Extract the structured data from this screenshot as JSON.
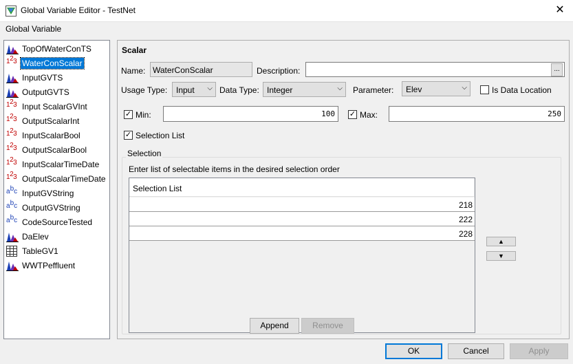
{
  "window": {
    "title": "Global Variable Editor - TestNet",
    "close_label": "✕"
  },
  "menu": {
    "label": "Global Variable"
  },
  "tree": {
    "items": [
      {
        "label": "TopOfWaterConTS",
        "icon": "timeseries-icon"
      },
      {
        "label": "WaterConScalar",
        "icon": "numeric-icon",
        "selected": true
      },
      {
        "label": "InputGVTS",
        "icon": "timeseries-icon"
      },
      {
        "label": "OutputGVTS",
        "icon": "timeseries-icon"
      },
      {
        "label": "Input ScalarGVInt",
        "icon": "numeric-icon"
      },
      {
        "label": "OutputScalarInt",
        "icon": "numeric-icon"
      },
      {
        "label": "InputScalarBool",
        "icon": "numeric-icon"
      },
      {
        "label": "OutputScalarBool",
        "icon": "numeric-icon"
      },
      {
        "label": "InputScalarTimeDate",
        "icon": "numeric-icon"
      },
      {
        "label": "OutputScalarTimeDate",
        "icon": "numeric-icon"
      },
      {
        "label": "InputGVString",
        "icon": "string-icon"
      },
      {
        "label": "OutputGVString",
        "icon": "string-icon"
      },
      {
        "label": "CodeSourceTested",
        "icon": "string-icon"
      },
      {
        "label": "DaElev",
        "icon": "timeseries-icon"
      },
      {
        "label": "TableGV1",
        "icon": "table-icon"
      },
      {
        "label": "WWTPeffluent",
        "icon": "timeseries-icon"
      }
    ],
    "icon_glyphs": {
      "numeric_main": "1",
      "numeric_sup": "2",
      "numeric_tail": "3",
      "string_main": "a",
      "string_sup": "b",
      "string_tail": "c"
    }
  },
  "scalar": {
    "section_title": "Scalar",
    "name_label": "Name:",
    "name_value": "WaterConScalar",
    "description_label": "Description:",
    "description_value": "",
    "description_button": "...",
    "usage_type_label": "Usage Type:",
    "usage_type_value": "Input",
    "data_type_label": "Data Type:",
    "data_type_value": "Integer",
    "parameter_label": "Parameter:",
    "parameter_value": "Elev",
    "is_data_location_label": "Is Data Location",
    "is_data_location_checked": false,
    "min_label": "Min:",
    "min_checked": true,
    "min_value": "100",
    "max_label": "Max:",
    "max_checked": true,
    "max_value": "250",
    "selection_list_label": "Selection List",
    "selection_list_checked": true,
    "check_glyph": "✓",
    "dropdown_glyph": "⌵"
  },
  "selection": {
    "group_title": "Selection",
    "instructions": "Enter list of selectable items in the desired selection order",
    "column_header": "Selection List",
    "rows": [
      "218",
      "222",
      "228"
    ],
    "move_up_glyph": "▲",
    "move_down_glyph": "▼",
    "append_label": "Append",
    "remove_label": "Remove"
  },
  "footer": {
    "ok_label": "OK",
    "cancel_label": "Cancel",
    "apply_label": "Apply"
  },
  "colors": {
    "selection_blue": "#0078d7",
    "numeric_icon": "#c00000",
    "string_icon": "#1a3fb5"
  }
}
